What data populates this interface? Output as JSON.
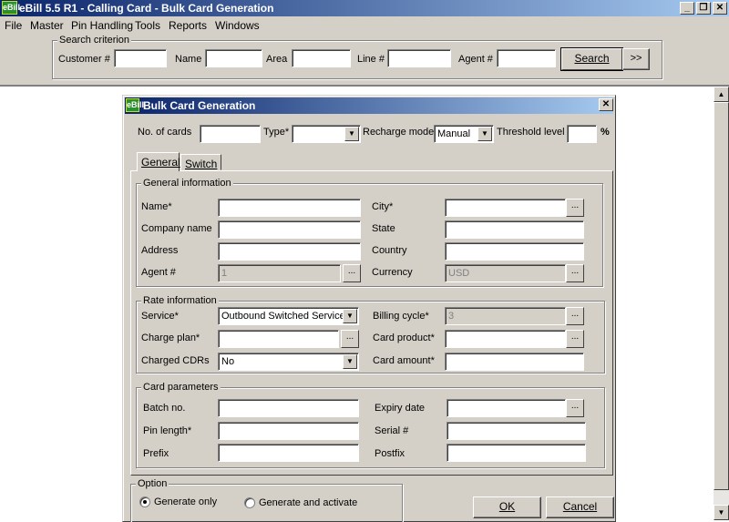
{
  "app": {
    "title": "eBill 5.5 R1 - Calling Card - Bulk Card Generation",
    "icon_text": "eBill",
    "window_buttons": [
      "_",
      "❐",
      "✕"
    ]
  },
  "menu": [
    "File",
    "Master",
    "Pin Handling",
    "Tools",
    "Reports",
    "Windows"
  ],
  "search": {
    "group_label": "Search criterion",
    "customer_label": "Customer #",
    "name_label": "Name",
    "area_label": "Area",
    "line_label": "Line #",
    "agent_label": "Agent #",
    "search_button": "Search",
    "more_button": ">>"
  },
  "dialog": {
    "title": "Bulk Card Generation",
    "close": "✕",
    "top": {
      "no_of_cards_label": "No. of cards",
      "type_label": "Type*",
      "recharge_label": "Recharge mode",
      "recharge_value": "Manual",
      "threshold_label": "Threshold level",
      "percent": "%"
    },
    "tabs": [
      "General",
      "Switch"
    ],
    "general_info": {
      "group_label": "General information",
      "name_label": "Name*",
      "company_label": "Company name",
      "address_label": "Address",
      "agent_label": "Agent #",
      "agent_value": "1",
      "city_label": "City*",
      "state_label": "State",
      "country_label": "Country",
      "currency_label": "Currency",
      "currency_value": "USD"
    },
    "rate_info": {
      "group_label": "Rate information",
      "service_label": "Service*",
      "service_value": "Outbound Switched Service",
      "charge_plan_label": "Charge plan*",
      "charged_cdrs_label": "Charged CDRs",
      "charged_cdrs_value": "No",
      "billing_cycle_label": "Billing cycle*",
      "billing_cycle_value": "3",
      "card_product_label": "Card product*",
      "card_amount_label": "Card amount*"
    },
    "card_params": {
      "group_label": "Card parameters",
      "batch_label": "Batch no.",
      "pin_length_label": "Pin length*",
      "prefix_label": "Prefix",
      "expiry_label": "Expiry date",
      "serial_label": "Serial #",
      "postfix_label": "Postfix"
    },
    "option": {
      "group_label": "Option",
      "generate_only": "Generate only",
      "generate_activate": "Generate and activate",
      "selected": "Generate only"
    },
    "ok_button": "OK",
    "cancel_button": "Cancel",
    "dots": "..."
  },
  "colors": {
    "titlebar_start": "#0a246a",
    "titlebar_end": "#a6caf0",
    "face": "#d4d0c8"
  }
}
